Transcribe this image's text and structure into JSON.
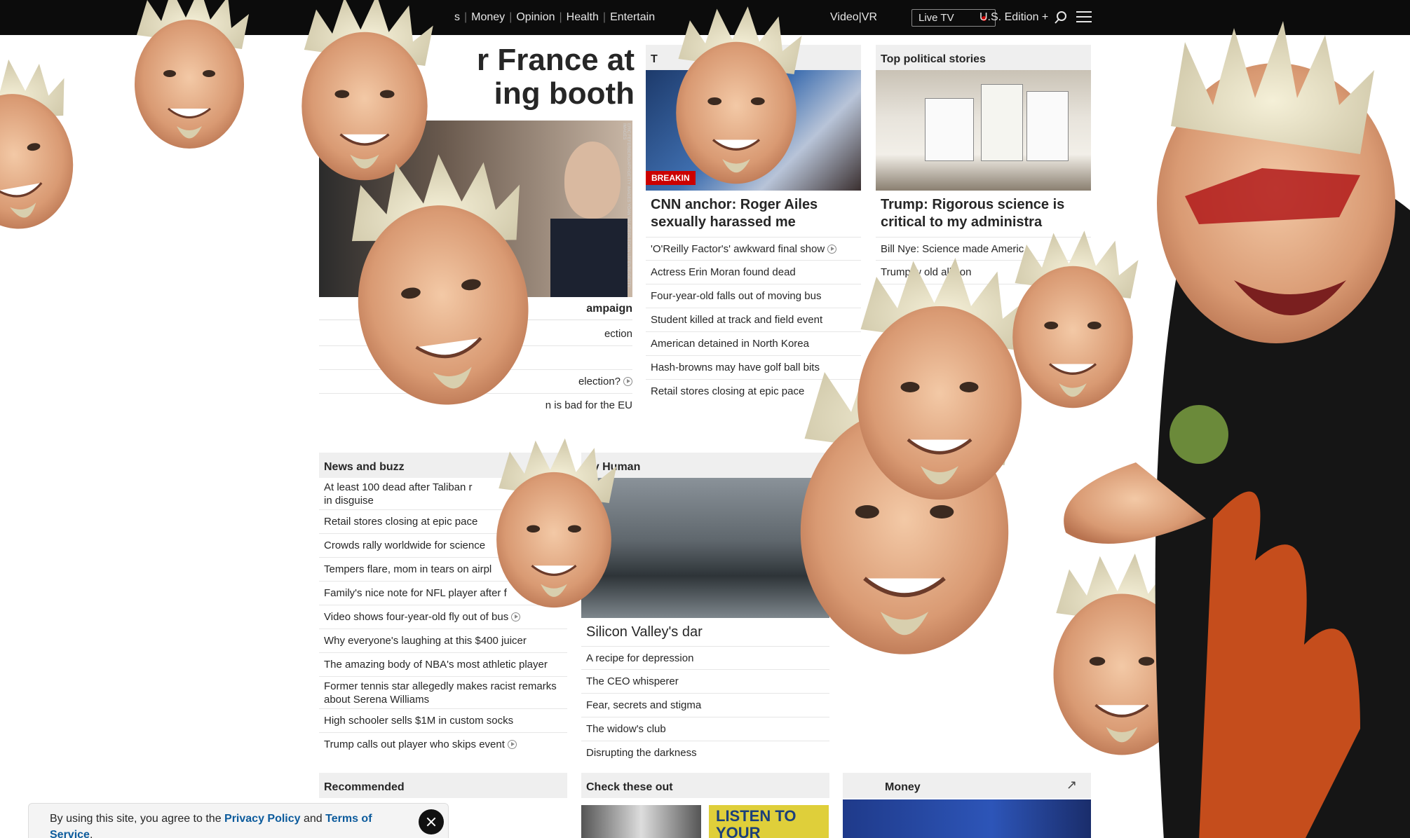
{
  "nav": {
    "items": [
      "s",
      "Money",
      "Opinion",
      "Health",
      "Entertain"
    ],
    "right_items": [
      "Video",
      "VR"
    ],
    "live_tv": "Live TV",
    "edition": "U.S. Edition +",
    "colors": {
      "bar": "#0c0c0c",
      "live_dot": "#cc0000"
    }
  },
  "lead": {
    "title": "r France at\ning booth",
    "bold_link": "ampaign",
    "links": [
      "ection",
      "",
      "election?",
      "n is bad for the EU"
    ],
    "credit": "ERIC FEFERBERG/AFP/GETTY IMAGES  YOAN VALAT/EPA  EDIEN LEFEVRE/GETTY IMAGES"
  },
  "top_stories": {
    "header": "T",
    "badge": "BREAKIN",
    "headline": "CNN anchor: Roger Ailes sexually harassed me",
    "links": [
      "'O'Reilly Factor's' awkward final show",
      "Actress Erin Moran found dead",
      "Four-year-old falls out of moving bus",
      "Student killed at track and field event",
      "American detained in North Korea",
      "Hash-browns may have golf ball bits",
      "Retail stores closing at epic pace"
    ]
  },
  "political": {
    "header": "Top political stories",
    "headline": "Trump: Rigorous science is critical to my administra",
    "links": [
      "Bill Nye: Science made Americ",
      "Trump w     old     ally on"
    ]
  },
  "news_buzz": {
    "header": "News and buzz",
    "links": [
      "At least 100 dead after Taliban r\nin disguise",
      "Retail stores closing at epic pace",
      "Crowds rally worldwide for science",
      "Tempers flare, mom in tears on airpl",
      "Family's nice note for NFL player after f",
      "Video shows four-year-old fly out of bus",
      "Why everyone's laughing at this $400 juicer",
      "The amazing body of NBA's most athletic player",
      "Former tennis star allegedly makes racist remarks about Serena Williams",
      "High schooler sells $1M in custom socks",
      "Trump calls out player who skips event"
    ]
  },
  "human": {
    "header": "tly Human",
    "headline": "Silicon Valley's dar",
    "links": [
      "A recipe for depression",
      "The CEO whisperer",
      "Fear, secrets and stigma",
      "The widow's club",
      "Disrupting the darkness"
    ]
  },
  "bottom": {
    "recommended": "Recommended",
    "check_these_out": "Check these out",
    "money": "Money",
    "thumb_text": "LISTEN  TO YOUR"
  },
  "cookie": {
    "text_before": "By using this site, you agree to the ",
    "privacy": "Privacy Policy",
    "and": " and ",
    "terms": "Terms of Service",
    "period": "."
  }
}
